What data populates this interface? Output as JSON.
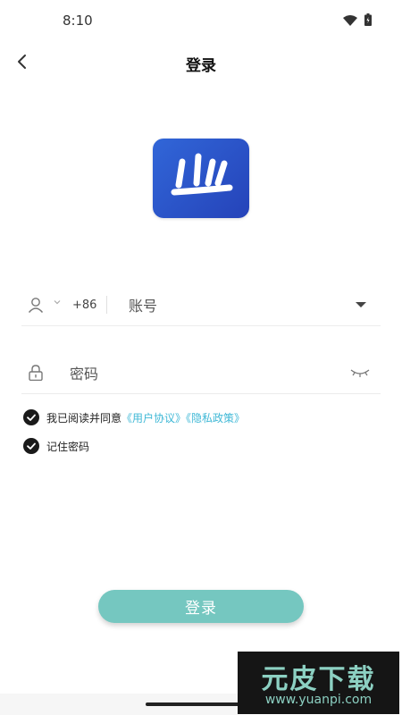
{
  "status_bar": {
    "time": "8:10"
  },
  "header": {
    "title": "登录"
  },
  "form": {
    "country_code": "+86",
    "account_placeholder": "账号",
    "password_placeholder": "密码"
  },
  "agreement": {
    "prefix": "我已阅读并同意",
    "user_agreement": "《用户协议》",
    "privacy_policy": "《隐私政策》"
  },
  "remember": {
    "label": "记住密码"
  },
  "login_button": {
    "label": "登录"
  },
  "watermark": {
    "title": "元皮下载",
    "url": "www.yuanpi.com"
  },
  "colors": {
    "accent_button": "#75c7c0",
    "link": "#3fb8d6",
    "logo_blue": "#2e5bd0"
  },
  "icons": [
    "wifi-icon",
    "battery-icon",
    "back-icon",
    "user-icon",
    "chevron-down-icon",
    "dropdown-icon",
    "lock-icon",
    "eye-closed-icon",
    "check-icon"
  ]
}
